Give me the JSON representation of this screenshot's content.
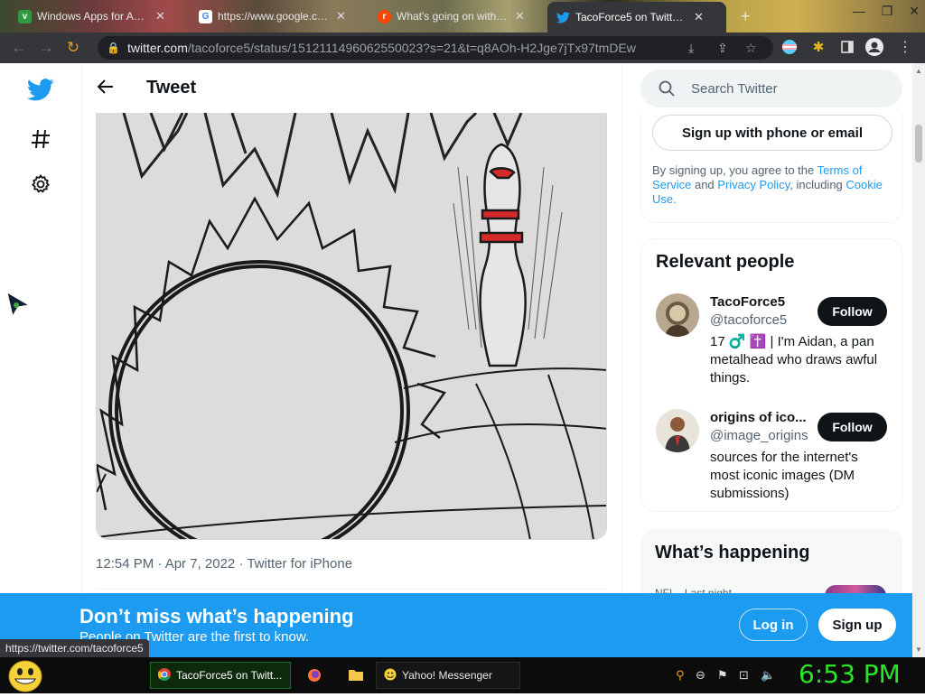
{
  "browser": {
    "tabs": [
      {
        "title": "Windows Apps for Ama...",
        "favicon": "green-square-icon"
      },
      {
        "title": "https://www.google.com",
        "favicon": "google-g-icon"
      },
      {
        "title": "What's going on with t...",
        "favicon": "reddit-icon"
      },
      {
        "title": "TacoForce5 on Twitter: \"@...",
        "favicon": "twitter-bird-icon",
        "active": true
      }
    ],
    "new_tab": "+",
    "url_host": "twitter.com",
    "url_path": "/tacoforce5/status/1512111496062550023?s=21&t=q8AOh-H2Jge7jTx97tmDEw"
  },
  "tweet": {
    "header_title": "Tweet",
    "meta": "12:54 PM · Apr 7, 2022 · Twitter for iPhone"
  },
  "sidebar": {
    "search_placeholder": "Search Twitter",
    "signup_button": "Sign up with phone or email",
    "terms_prefix": "By signing up, you agree to the ",
    "terms_link": "Terms of Service",
    "terms_and": " and ",
    "privacy_link": "Privacy Policy",
    "terms_including": ", including ",
    "cookie_link": "Cookie Use.",
    "relevant_people_title": "Relevant people",
    "people": [
      {
        "name": "TacoForce5",
        "handle": "@tacoforce5",
        "bio": "17 ♂️ ✝️ | I'm Aidan, a pan metalhead who draws awful things.",
        "follow": "Follow"
      },
      {
        "name": "origins of ico...",
        "handle": "@image_origins",
        "bio": "sources for the internet's most iconic images (DM submissions)",
        "follow": "Follow"
      }
    ],
    "happening_title": "What’s happening",
    "happening_sub": "NFL · Last night"
  },
  "banner": {
    "title": "Don’t miss what’s happening",
    "subtitle": "People on Twitter are the first to know.",
    "login": "Log in",
    "signup": "Sign up"
  },
  "status_url": "https://twitter.com/tacoforce5",
  "taskbar": {
    "items": [
      {
        "label": "TacoForce5 on Twitt...",
        "active": true
      },
      {
        "label": "Yahoo! Messenger",
        "active": false
      }
    ],
    "clock": "6:53 PM"
  },
  "colors": {
    "twitter_blue": "#1d9bf0",
    "clock_green": "#29e629",
    "follow_black": "#0f1419"
  }
}
